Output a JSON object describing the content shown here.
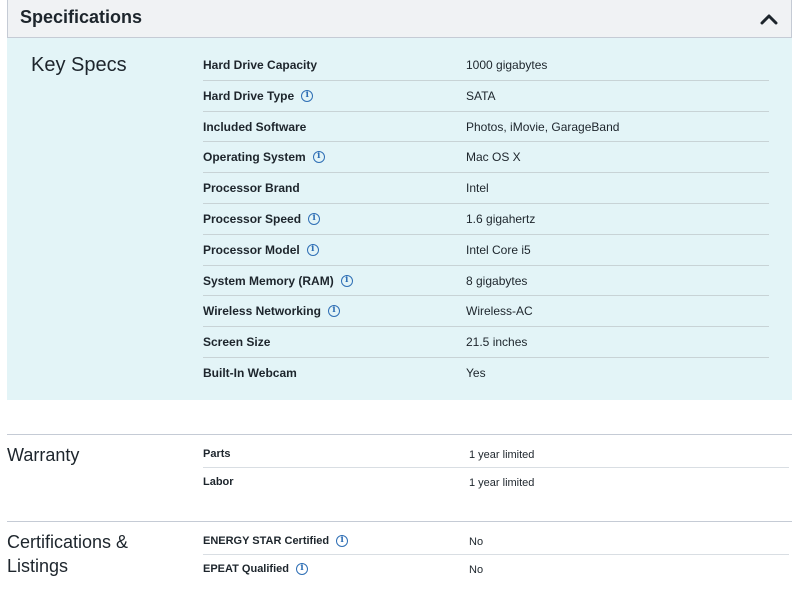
{
  "header": {
    "title": "Specifications"
  },
  "key_specs": {
    "title": "Key Specs",
    "rows": [
      {
        "label": "Hard Drive Capacity",
        "value": "1000 gigabytes",
        "info": false
      },
      {
        "label": "Hard Drive Type",
        "value": "SATA",
        "info": true
      },
      {
        "label": "Included Software",
        "value": "Photos, iMovie, GarageBand",
        "info": false
      },
      {
        "label": "Operating System",
        "value": "Mac OS X",
        "info": true
      },
      {
        "label": "Processor Brand",
        "value": "Intel",
        "info": false
      },
      {
        "label": "Processor Speed",
        "value": "1.6 gigahertz",
        "info": true
      },
      {
        "label": "Processor Model",
        "value": "Intel Core i5",
        "info": true
      },
      {
        "label": "System Memory (RAM)",
        "value": "8 gigabytes",
        "info": true
      },
      {
        "label": "Wireless Networking",
        "value": "Wireless-AC",
        "info": true
      },
      {
        "label": "Screen Size",
        "value": "21.5 inches",
        "info": false
      },
      {
        "label": "Built-In Webcam",
        "value": "Yes",
        "info": false
      }
    ]
  },
  "warranty": {
    "title": "Warranty",
    "rows": [
      {
        "label": "Parts",
        "value": "1 year limited",
        "info": false
      },
      {
        "label": "Labor",
        "value": "1 year limited",
        "info": false
      }
    ]
  },
  "certifications": {
    "title": "Certifications & Listings",
    "rows": [
      {
        "label": "ENERGY STAR Certified",
        "value": "No",
        "info": true
      },
      {
        "label": "EPEAT Qualified",
        "value": "No",
        "info": true
      }
    ]
  },
  "icons": {
    "collapse": "chevron-up-icon",
    "info": "info-icon"
  },
  "colors": {
    "panel_bg": "#e3f4f7",
    "header_bg": "#f0f2f4",
    "info_blue": "#2f6fb5"
  }
}
